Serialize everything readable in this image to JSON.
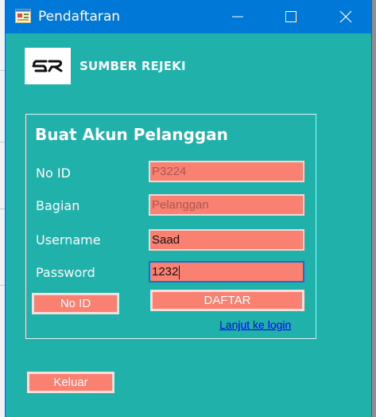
{
  "window": {
    "title": "Pendaftaran"
  },
  "brand": {
    "name": "SUMBER REJEKI",
    "logo_text": "SR"
  },
  "form": {
    "title": "Buat Akun Pelanggan",
    "fields": [
      {
        "label": "No ID",
        "value": "P3224"
      },
      {
        "label": "Bagian",
        "value": "Pelanggan"
      },
      {
        "label": "Username",
        "value": "Saad"
      },
      {
        "label": "Password",
        "value": "1232"
      }
    ],
    "no_id_button": "No ID",
    "register_button": "DAFTAR",
    "login_link": "Lanjut ke login"
  },
  "exit_button": "Keluar",
  "colors": {
    "window_bg": "#20b2aa",
    "titlebar": "#0078d7",
    "salmon": "#fa8072"
  },
  "icons": [
    "app-form-icon",
    "minimize-icon",
    "maximize-icon",
    "close-icon",
    "sr-logo-icon"
  ]
}
